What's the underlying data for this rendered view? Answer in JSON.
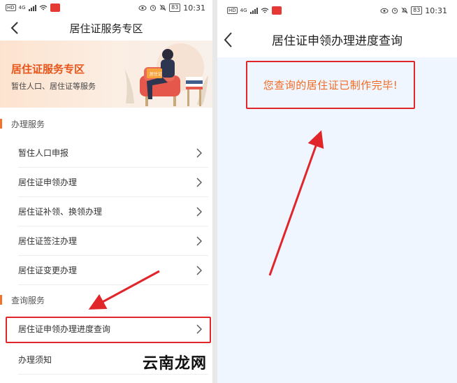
{
  "status": {
    "hd": "HD",
    "network": "4G",
    "battery": "83",
    "time": "10:31"
  },
  "left": {
    "title": "居住证服务专区",
    "banner": {
      "title": "居住证服务专区",
      "subtitle": "暂住人口、居住证等服务",
      "card_label": "居住证"
    },
    "sections": [
      {
        "label": "办理服务",
        "items": [
          "暂住人口申报",
          "居住证申领办理",
          "居住证补领、换领办理",
          "居住证签注办理",
          "居住证变更办理"
        ]
      },
      {
        "label": "查询服务",
        "items": [
          "居住证申领办理进度查询",
          "办理须知"
        ]
      }
    ]
  },
  "right": {
    "title": "居住证申领办理进度查询",
    "result": "您查询的居住证已制作完毕!"
  },
  "watermark": "云南龙网",
  "colors": {
    "accent": "#f0752b",
    "highlight": "#e0262a",
    "result_text": "#f26a22",
    "banner_title": "#e8541a"
  }
}
